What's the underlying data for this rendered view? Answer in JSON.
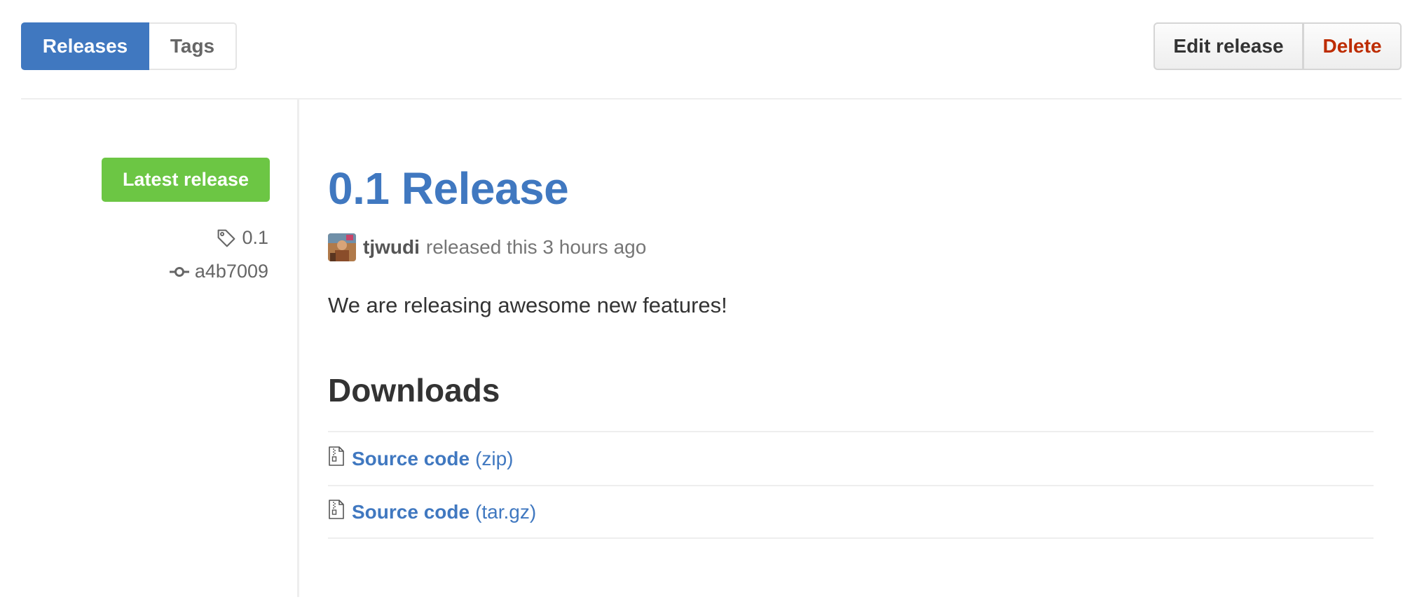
{
  "nav": {
    "releases_label": "Releases",
    "tags_label": "Tags"
  },
  "actions": {
    "edit_label": "Edit release",
    "delete_label": "Delete"
  },
  "meta": {
    "badge": "Latest release",
    "tag": "0.1",
    "commit": "a4b7009",
    "tag_icon": "tag-icon",
    "commit_icon": "git-commit-icon"
  },
  "release": {
    "title": "0.1 Release",
    "author": "tjwudi",
    "released_text": "released this 3 hours ago",
    "body": "We are releasing awesome new features!"
  },
  "downloads": {
    "heading": "Downloads",
    "items": [
      {
        "name": "Source code",
        "ext": "(zip)",
        "icon": "file-zip-icon"
      },
      {
        "name": "Source code",
        "ext": "(tar.gz)",
        "icon": "file-zip-icon"
      }
    ]
  },
  "colors": {
    "link": "#4078c0",
    "badge": "#6cc644",
    "danger": "#bd2c00"
  }
}
